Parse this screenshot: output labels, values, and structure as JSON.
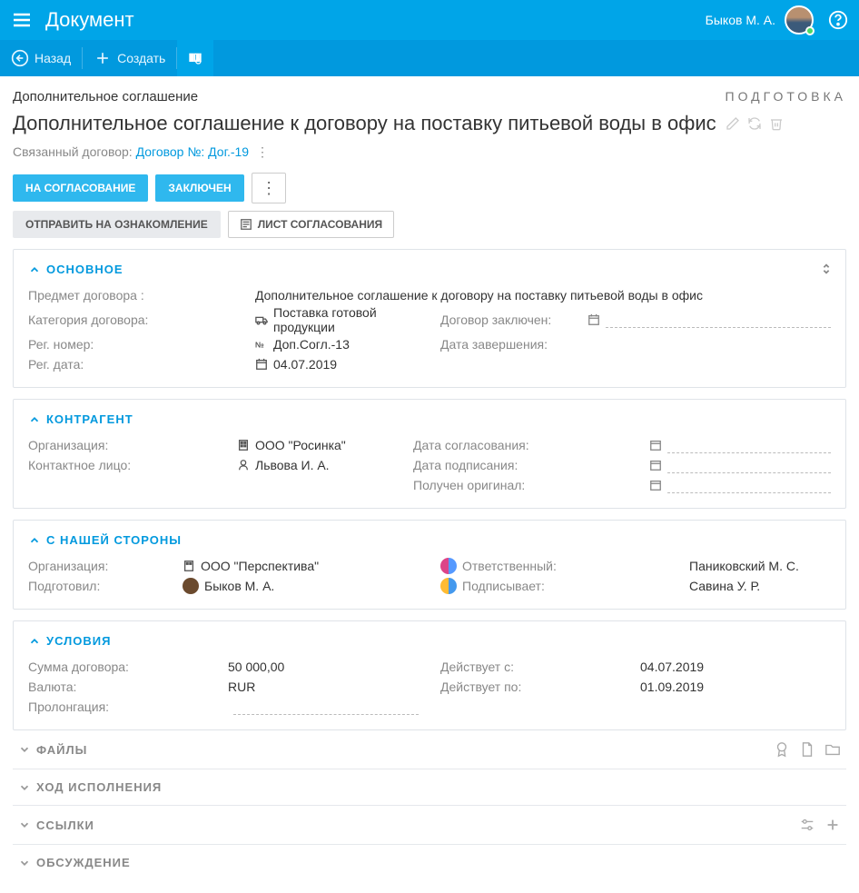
{
  "topbar": {
    "title": "Документ",
    "user": "Быков М. А."
  },
  "toolbar": {
    "back": "Назад",
    "create": "Создать"
  },
  "page": {
    "doc_type": "Дополнительное соглашение",
    "status": "ПОДГОТОВКА",
    "title": "Дополнительное соглашение к договору на поставку питьевой воды в офис",
    "linked_label": "Связанный договор:",
    "linked_value": "Договор №: Дог.-19"
  },
  "buttons": {
    "to_approval": "НА СОГЛАСОВАНИЕ",
    "concluded": "ЗАКЛЮЧЕН",
    "send_review": "ОТПРАВИТЬ НА ОЗНАКОМЛЕНИЕ",
    "approval_sheet": "ЛИСТ СОГЛАСОВАНИЯ"
  },
  "panels": {
    "main": {
      "title": "ОСНОВНОЕ",
      "subject_label": "Предмет договора :",
      "subject_value": "Дополнительное соглашение к договору на поставку питьевой воды в офис",
      "category_label": "Категория договора:",
      "category_value": "Поставка готовой продукции",
      "concluded_label": "Договор заключен:",
      "regnum_label": "Рег. номер:",
      "regnum_value": "Доп.Согл.-13",
      "end_label": "Дата завершения:",
      "regdate_label": "Рег. дата:",
      "regdate_value": "04.07.2019"
    },
    "counterparty": {
      "title": "КОНТРАГЕНТ",
      "org_label": "Организация:",
      "org_value": "ООО \"Росинка\"",
      "approval_date_label": "Дата согласования:",
      "contact_label": "Контактное лицо:",
      "contact_value": "Львова И. А.",
      "sign_date_label": "Дата подписания:",
      "original_label": "Получен оригинал:"
    },
    "ourside": {
      "title": "С НАШЕЙ СТОРОНЫ",
      "org_label": "Организация:",
      "org_value": "ООО \"Перспектива\"",
      "responsible_label": "Ответственный:",
      "responsible_value": "Паниковский М. С.",
      "prepared_label": "Подготовил:",
      "prepared_value": "Быков М. А.",
      "signer_label": "Подписывает:",
      "signer_value": "Савина У. Р."
    },
    "terms": {
      "title": "УСЛОВИЯ",
      "sum_label": "Сумма договора:",
      "sum_value": "50 000,00",
      "from_label": "Действует с:",
      "from_value": "04.07.2019",
      "currency_label": "Валюта:",
      "currency_value": "RUR",
      "to_label": "Действует по:",
      "to_value": "01.09.2019",
      "prolongation_label": "Пролонгация:"
    }
  },
  "sections": {
    "files": "ФАЙЛЫ",
    "progress": "ХОД ИСПОЛНЕНИЯ",
    "links": "ССЫЛКИ",
    "discussion": "ОБСУЖДЕНИЕ"
  }
}
